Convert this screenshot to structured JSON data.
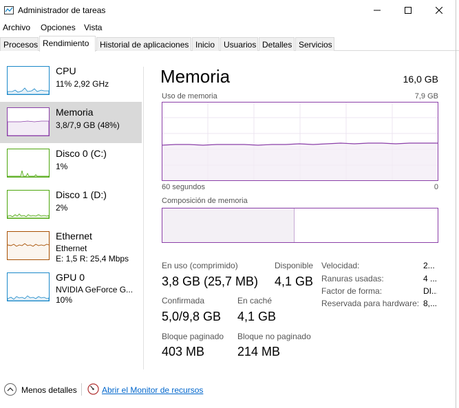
{
  "window": {
    "title": "Administrador de tareas"
  },
  "menu": [
    "Archivo",
    "Opciones",
    "Vista"
  ],
  "tabs": [
    "Procesos",
    "Rendimiento",
    "Historial de aplicaciones",
    "Inicio",
    "Usuarios",
    "Detalles",
    "Servicios"
  ],
  "colors": {
    "cpu": "#1a88c9",
    "memory": "#8b3fa8",
    "disk": "#4da60c",
    "ethernet": "#a74f01",
    "gpu": "#1a88c9",
    "selected": "#d9d9d9"
  },
  "sidebar": {
    "items": [
      {
        "title": "CPU",
        "sub1": "11%  2,92 GHz",
        "sub2": "",
        "sub3": "",
        "icon": "cpu-graph"
      },
      {
        "title": "Memoria",
        "sub1": "3,8/7,9 GB (48%)",
        "sub2": "",
        "sub3": "",
        "icon": "memory-graph"
      },
      {
        "title": "Disco 0 (C:)",
        "sub1": "1%",
        "sub2": "",
        "sub3": "",
        "icon": "disk-graph"
      },
      {
        "title": "Disco 1 (D:)",
        "sub1": "2%",
        "sub2": "",
        "sub3": "",
        "icon": "disk-graph"
      },
      {
        "title": "Ethernet",
        "sub1": "Ethernet",
        "sub2": "E: 1,5  R: 25,4 Mbps",
        "sub3": "",
        "icon": "ethernet-graph"
      },
      {
        "title": "GPU 0",
        "sub1": "NVIDIA GeForce G...",
        "sub2": "10%",
        "sub3": "",
        "icon": "gpu-graph"
      }
    ]
  },
  "main": {
    "title": "Memoria",
    "total": "16,0 GB",
    "usage_label": "Uso de memoria",
    "usage_max": "7,9 GB",
    "time_left": "60 segundos",
    "time_right": "0",
    "composition_label": "Composición de memoria",
    "used_fraction": 0.48,
    "stats": {
      "in_use_label": "En uso (comprimido)",
      "in_use_value": "3,8 GB (25,7 MB)",
      "available_label": "Disponible",
      "available_value": "4,1 GB",
      "committed_label": "Confirmada",
      "committed_value": "5,0/9,8 GB",
      "cached_label": "En caché",
      "cached_value": "4,1 GB",
      "paged_label": "Bloque paginado",
      "paged_value": "403 MB",
      "nonpaged_label": "Bloque no paginado",
      "nonpaged_value": "214 MB"
    },
    "specs": [
      {
        "label": "Velocidad:",
        "value": "2..."
      },
      {
        "label": "Ranuras usadas:",
        "value": "4 ..."
      },
      {
        "label": "Factor de forma:",
        "value": "DI..."
      },
      {
        "label": "Reservada para hardware:",
        "value": "8,..."
      }
    ]
  },
  "footer": {
    "less_details": "Menos detalles",
    "open_monitor": "Abrir el Monitor de recursos"
  }
}
